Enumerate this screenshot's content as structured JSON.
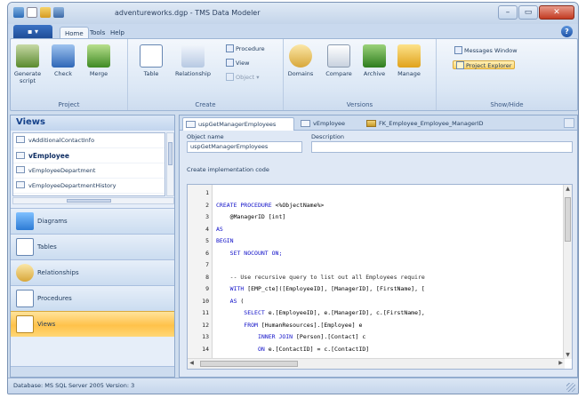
{
  "window": {
    "title": "adventureworks.dgp - TMS Data Modeler"
  },
  "ribbon": {
    "tabs": [
      {
        "label": "Home",
        "active": true
      },
      {
        "label": "Tools",
        "active": false
      },
      {
        "label": "Help",
        "active": false
      }
    ],
    "groups": {
      "project": {
        "label": "Project",
        "buttons": [
          {
            "label": "Generate script",
            "icon": "generate-script-icon"
          },
          {
            "label": "Check",
            "icon": "check-icon"
          },
          {
            "label": "Merge",
            "icon": "merge-icon"
          }
        ]
      },
      "create": {
        "label": "Create",
        "buttons": [
          {
            "label": "Table",
            "icon": "table-icon"
          },
          {
            "label": "Relationship",
            "icon": "relationship-icon"
          }
        ],
        "small": [
          {
            "label": "Procedure",
            "icon": "procedure-icon"
          },
          {
            "label": "View",
            "icon": "view-icon"
          },
          {
            "label": "Object",
            "icon": "object-icon",
            "enabled": false
          }
        ]
      },
      "versions": {
        "label": "Versions",
        "buttons": [
          {
            "label": "Domains",
            "icon": "domains-icon"
          },
          {
            "label": "Compare",
            "icon": "compare-icon"
          },
          {
            "label": "Archive",
            "icon": "archive-icon"
          },
          {
            "label": "Manage",
            "icon": "manage-icon"
          }
        ]
      },
      "showhide": {
        "label": "Show/Hide",
        "small": [
          {
            "label": "Messages Window",
            "icon": "messages-window-icon"
          },
          {
            "label": "Project Explorer",
            "icon": "project-explorer-icon",
            "active": true
          }
        ]
      }
    }
  },
  "left_panel": {
    "title": "Views",
    "items": [
      {
        "label": "vAdditionalContactInfo",
        "selected": false
      },
      {
        "label": "vEmployee",
        "selected": true
      },
      {
        "label": "vEmployeeDepartment",
        "selected": false
      },
      {
        "label": "vEmployeeDepartmentHistory",
        "selected": false
      }
    ],
    "nav": [
      {
        "label": "Diagrams",
        "icon": "diagrams-icon",
        "active": false
      },
      {
        "label": "Tables",
        "icon": "tables-icon",
        "active": false
      },
      {
        "label": "Relationships",
        "icon": "relationships-icon",
        "active": false
      },
      {
        "label": "Procedures",
        "icon": "procedures-icon",
        "active": false
      },
      {
        "label": "Views",
        "icon": "views-icon",
        "active": true
      }
    ]
  },
  "document": {
    "tabs": [
      {
        "label": "uspGetManagerEmployees",
        "active": true
      },
      {
        "label": "vEmployee",
        "active": false
      },
      {
        "label": "FK_Employee_Employee_ManagerID",
        "active": false
      }
    ],
    "object_name_label": "Object name",
    "object_name_value": "uspGetManagerEmployees",
    "description_label": "Description",
    "description_value": "",
    "code_label": "Create implementation code",
    "code_lines": [
      {
        "n": "1",
        "kw": "",
        "text": ""
      },
      {
        "n": "2",
        "kw": "CREATE PROCEDURE ",
        "text": "<%ObjectName%>"
      },
      {
        "n": "3",
        "kw": "",
        "text": "    @ManagerID [int]"
      },
      {
        "n": "4",
        "kw": "AS",
        "text": ""
      },
      {
        "n": "5",
        "kw": "BEGIN",
        "text": ""
      },
      {
        "n": "6",
        "kw": "    SET NOCOUNT ON;",
        "text": ""
      },
      {
        "n": "7",
        "kw": "",
        "text": ""
      },
      {
        "n": "8",
        "kw": "",
        "text": "    -- Use recursive query to list out all Employees require"
      },
      {
        "n": "9",
        "kw": "    WITH ",
        "text": "[EMP_cte]([EmployeeID], [ManagerID], [FirstName], ["
      },
      {
        "n": "10",
        "kw": "    AS",
        "text": " ("
      },
      {
        "n": "11",
        "kw": "        SELECT ",
        "text": "e.[EmployeeID], e.[ManagerID], c.[FirstName],"
      },
      {
        "n": "12",
        "kw": "        FROM ",
        "text": "[HumanResources].[Employee] e"
      },
      {
        "n": "13",
        "kw": "            INNER JOIN ",
        "text": "[Person].[Contact] c"
      },
      {
        "n": "14",
        "kw": "            ON ",
        "text": "e.[ContactID] = c.[ContactID]"
      }
    ]
  },
  "status": {
    "text": "Database: MS SQL Server 2005   Version: 3"
  },
  "colors": {
    "accent": "#ffc24a",
    "keyword": "#1010c8",
    "ribbon_tab": "#1c4a94"
  }
}
